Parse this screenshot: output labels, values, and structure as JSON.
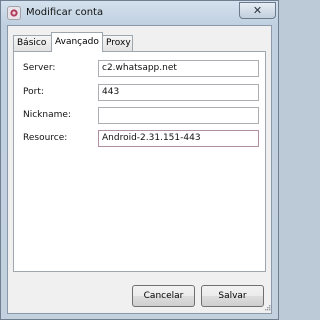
{
  "window": {
    "title": "Modificar conta",
    "close_label": "✕"
  },
  "tabs": [
    {
      "label": "Básico",
      "active": false
    },
    {
      "label": "Avançado",
      "active": true
    },
    {
      "label": "Proxy",
      "active": false
    }
  ],
  "form": {
    "server": {
      "label": "Server:",
      "value": "c2.whatsapp.net"
    },
    "port": {
      "label": "Port:",
      "value": "443"
    },
    "nickname": {
      "label": "Nickname:",
      "value": ""
    },
    "resource": {
      "label": "Resource:",
      "value": "Android-2.31.151-443"
    }
  },
  "buttons": {
    "cancel": "Cancelar",
    "save": "Salvar"
  },
  "icons": {
    "app": "pidgin-app-icon",
    "close": "close-icon",
    "grip": "resize-grip-icon"
  },
  "colors": {
    "title_bar": "#c3d1de",
    "panel": "#ffffff",
    "dialog": "#f0f0f0"
  }
}
